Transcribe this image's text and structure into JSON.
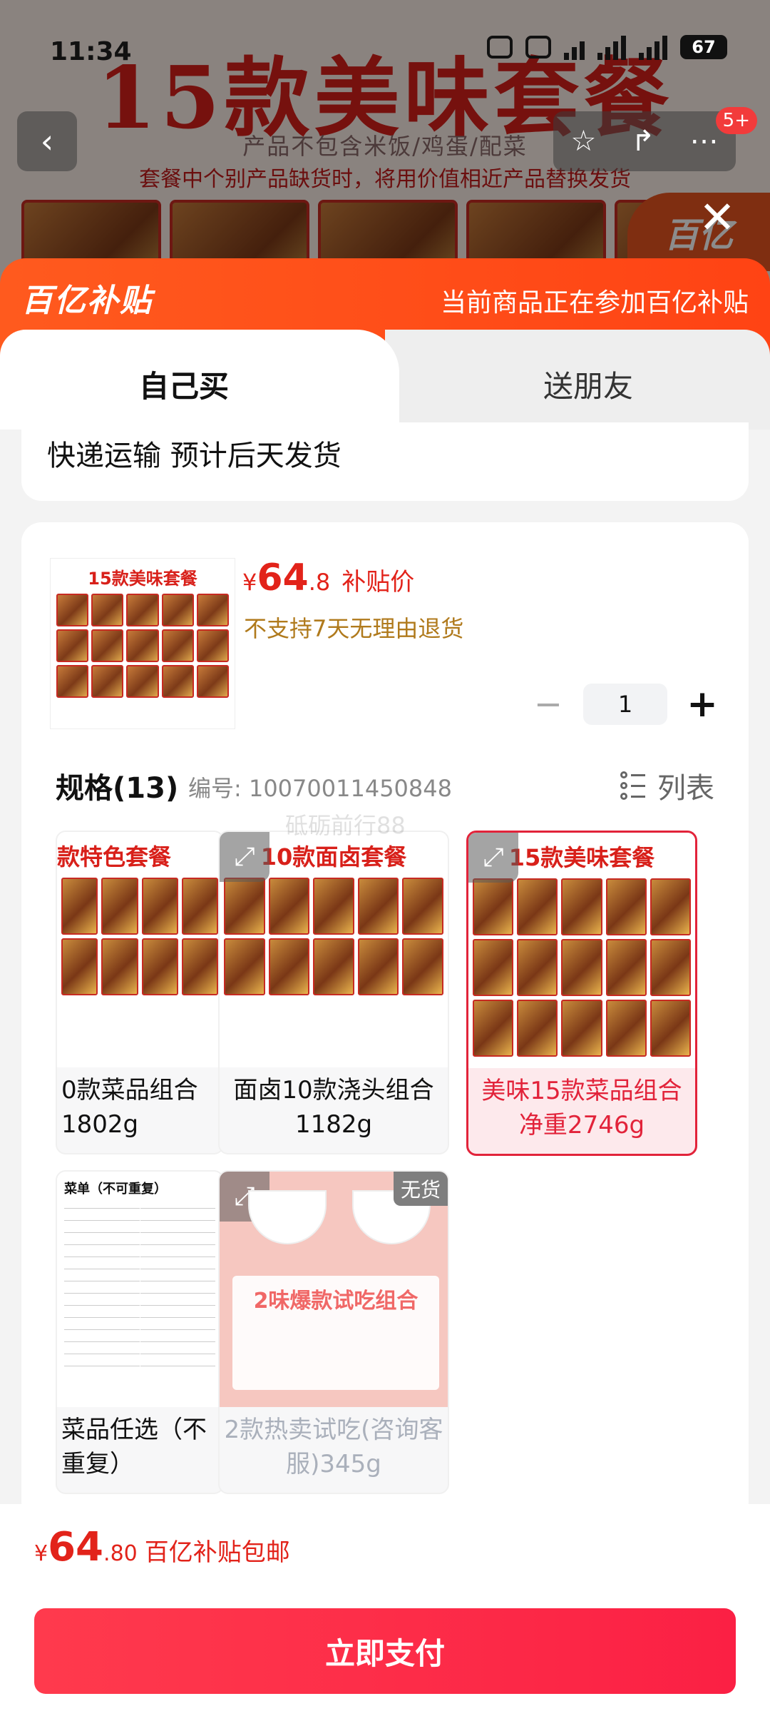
{
  "status_bar": {
    "time": "11:34",
    "battery": "67"
  },
  "background": {
    "banner_title": "15款美味套餐",
    "banner_sub": "产品不包含米饭/鸡蛋/配菜",
    "banner_note": "套餐中个别产品缺货时，将用价值相近产品替换发货",
    "cart_badge": "5+",
    "logo_text": "百亿"
  },
  "sheet": {
    "logo": "百亿补贴",
    "promo_text": "当前商品正在参加百亿补贴",
    "tabs": [
      "自己买",
      "送朋友"
    ],
    "shipping": "快递运输 预计后天发货"
  },
  "product": {
    "thumb_title": "15款美味套餐",
    "price_symbol": "¥",
    "price_int": "64",
    "price_dec": ".8",
    "price_label": "补贴价",
    "return_policy": "不支持7天无理由退货",
    "quantity": "1"
  },
  "spec": {
    "title": "规格(13)",
    "code": "编号: 10070011450848",
    "view_label": "列表",
    "watermark": "砥砺前行88",
    "items": [
      {
        "img_title": "款特色套餐",
        "name": "0款菜品组合 1802g"
      },
      {
        "img_title": "10款面卤套餐",
        "name": "面卤10款浇头组合 1182g"
      },
      {
        "img_title": "15款美味套餐",
        "name": "美味15款菜品组合 净重2746g"
      },
      {
        "img_title": "菜单（不可重复）",
        "name": "菜品任选（不 重复）"
      },
      {
        "img_title": "2味爆款试吃组合",
        "name": "2款热卖试吃(咨询客服)345g",
        "stock_label": "无货"
      }
    ]
  },
  "bottom": {
    "symbol": "¥",
    "price_int": "64",
    "price_dec": ".80",
    "tag": "百亿补贴包邮",
    "pay_button": "立即支付"
  }
}
